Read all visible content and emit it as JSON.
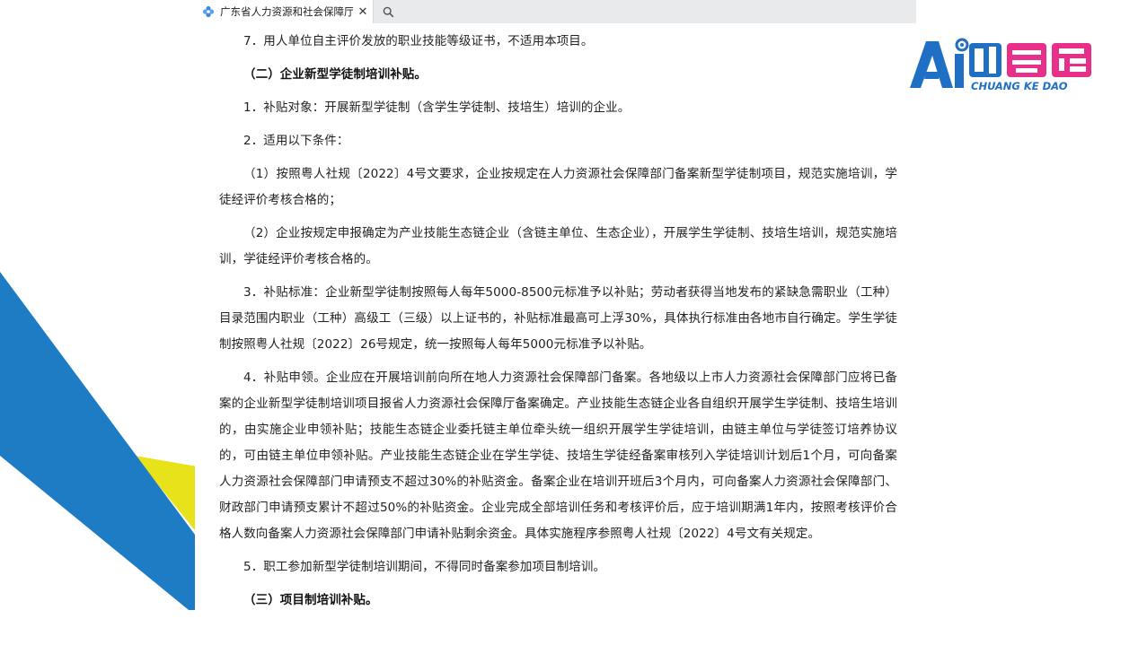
{
  "browser": {
    "tab_title": "广东省人力资源和社会保障厅",
    "close_glyph": "✕",
    "favicon": "flower-icon",
    "search_icon": "search-icon"
  },
  "logo": {
    "mark": "AI创客岛",
    "subtitle": "CHUANG KE DAO",
    "colors": {
      "blue": "#1f6fc5",
      "pink": "#e8308a"
    }
  },
  "content": {
    "paragraphs": [
      "7．用人单位自主评价发放的职业技能等级证书，不适用本项目。",
      "（二）企业新型学徒制培训补贴。",
      "1．补贴对象：开展新型学徒制（含学生学徒制、技培生）培训的企业。",
      "2．适用以下条件：",
      "（1）按照粤人社规〔2022〕4号文要求，企业按规定在人力资源社会保障部门备案新型学徒制项目，规范实施培训，学徒经评价考核合格的；",
      "（2）企业按规定申报确定为产业技能生态链企业（含链主单位、生态企业），开展学生学徒制、技培生培训，规范实施培训，学徒经评价考核合格的。",
      "3．补贴标准：企业新型学徒制按照每人每年5000-8500元标准予以补贴；劳动者获得当地发布的紧缺急需职业（工种）目录范围内职业（工种）高级工（三级）以上证书的，补贴标准最高可上浮30%，具体执行标准由各地市自行确定。学生学徒制按照粤人社规〔2022〕26号规定，统一按照每人每年5000元标准予以补贴。",
      "4．补贴申领。企业应在开展培训前向所在地人力资源社会保障部门备案。各地级以上市人力资源社会保障部门应将已备案的企业新型学徒制培训项目报省人力资源社会保障厅备案确定。产业技能生态链企业各自组织开展学生学徒制、技培生培训的，由实施企业申领补贴；技能生态链企业委托链主单位牵头统一组织开展学生学徒培训，由链主单位与学徒签订培养协议的，可由链主单位申领补贴。产业技能生态链企业在学生学徒、技培生学徒经备案审核列入学徒培训计划后1个月，可向备案人力资源社会保障部门申请预支不超过30%的补贴资金。备案企业在培训开班后3个月内，可向备案人力资源社会保障部门、财政部门申请预支累计不超过50%的补贴资金。企业完成全部培训任务和考核评价后，应于培训期满1年内，按照考核评价合格人数向备案人力资源社会保障部门申请补贴剩余资金。具体实施程序参照粤人社规〔2022〕4号文有关规定。",
      "5．职工参加新型学徒制培训期间，不得同时备案参加项目制培训。",
      "（三）项目制培训补贴。"
    ]
  },
  "decor_colors": {
    "blue": "#1e7cc4",
    "yellow": "#e8e21a"
  }
}
